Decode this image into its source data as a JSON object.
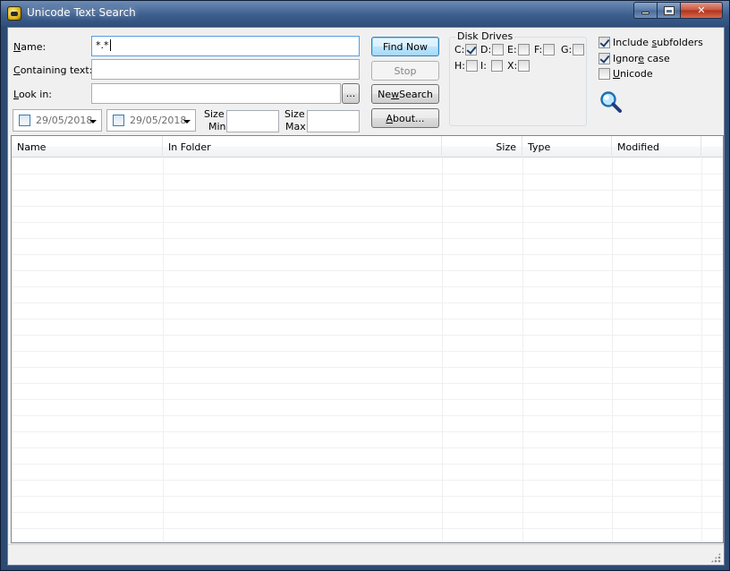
{
  "window": {
    "title": "Unicode Text Search"
  },
  "form": {
    "name_label_underlined": "N",
    "name_label_rest": "ame:",
    "name_value": "*.*",
    "containing_label_underlined": "C",
    "containing_label_rest": "ontaining text:",
    "containing_value": "",
    "lookin_label_underlined": "L",
    "lookin_label_rest": "ook in:",
    "lookin_value": "",
    "browse_label": "...",
    "date_from": "29/05/2018",
    "date_to": "29/05/2018",
    "size_min_label_top": "Size",
    "size_min_label_bottom": "Min",
    "size_max_label_top": "Size",
    "size_max_label_bottom": "Max",
    "size_min_value": "",
    "size_max_value": ""
  },
  "buttons": {
    "find_now": "Find Now",
    "stop": "Stop",
    "new_search_pre": "Ne",
    "new_search_ul": "w",
    "new_search_post": " Search",
    "about_ul": "A",
    "about_rest": "bout..."
  },
  "disk_drives": {
    "title": "Disk Drives",
    "drives": [
      {
        "label": "C:",
        "checked": true
      },
      {
        "label": "D:",
        "checked": false
      },
      {
        "label": "E:",
        "checked": false
      },
      {
        "label": "F:",
        "checked": false
      },
      {
        "label": "G:",
        "checked": false
      },
      {
        "label": "H:",
        "checked": false
      },
      {
        "label": "I:",
        "checked": false
      },
      {
        "label": "X:",
        "checked": false
      }
    ]
  },
  "options": {
    "include_subfolders_pre": "Include ",
    "include_subfolders_ul": "s",
    "include_subfolders_post": "ubfolders",
    "include_subfolders_checked": true,
    "ignore_case_pre": "Ignor",
    "ignore_case_ul": "e",
    "ignore_case_post": " case",
    "ignore_case_checked": true,
    "unicode_ul": "U",
    "unicode_rest": "nicode",
    "unicode_checked": false
  },
  "results": {
    "columns": [
      "Name",
      "In Folder",
      "Size",
      "Type",
      "Modified"
    ],
    "rows": []
  },
  "status": {
    "text": ""
  },
  "colors": {
    "titlebar": "#3d5f8d",
    "face": "#f0f0f0",
    "default_button": "#bee6fd",
    "close_button": "#c9533c"
  }
}
